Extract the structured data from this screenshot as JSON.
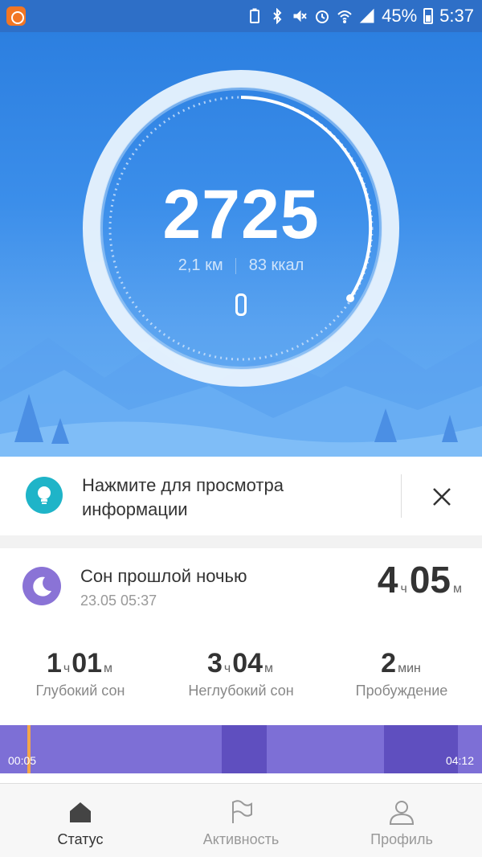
{
  "status_bar": {
    "battery": "45%",
    "time": "5:37"
  },
  "hero": {
    "steps": "2725",
    "distance_value": "2,1",
    "distance_unit": "км",
    "calories_value": "83",
    "calories_unit": "ккал"
  },
  "tip": {
    "text_line1": "Нажмите для просмотра",
    "text_line2": "информации"
  },
  "sleep": {
    "title": "Сон прошлой ночью",
    "date": "23.05 05:37",
    "total_hours": "4",
    "hours_unit": "ч",
    "total_minutes": "05",
    "minutes_unit": "м",
    "deep": {
      "h": "1",
      "hu": "ч",
      "m": "01",
      "mu": "м",
      "label": "Глубокий сон"
    },
    "light": {
      "h": "3",
      "hu": "ч",
      "m": "04",
      "mu": "м",
      "label": "Неглубокий сон"
    },
    "awake": {
      "m": "2",
      "mu": "мин",
      "label": "Пробуждение"
    },
    "timeline": {
      "start": "00:05",
      "end": "04:12"
    }
  },
  "nav": {
    "status": "Статус",
    "activity": "Активность",
    "profile": "Профиль"
  },
  "colors": {
    "accent": "#2e7fe0",
    "sleep_purple": "#7d6fd6",
    "deep_purple": "#5f4fbf",
    "tip_teal": "#1fb4c8",
    "active_nav": "#333333",
    "inactive_nav": "#999999"
  }
}
